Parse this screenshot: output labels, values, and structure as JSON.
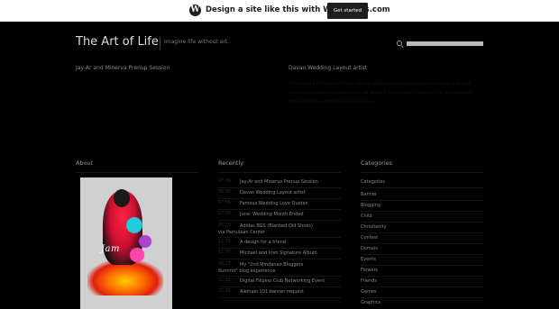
{
  "banner": {
    "logo": "W",
    "text": "Design a site like this with WordPress.com",
    "button": "Get started"
  },
  "header": {
    "title": "The Art of Life",
    "tagline": "Imagine life without art..",
    "search_icon": "search-icon",
    "search_placeholder": ""
  },
  "posts": [
    {
      "title": "Jay-Ar and Minerva Prenup Session"
    },
    {
      "title": "Davao Wedding Layout artist",
      "excerpt": "I'm a layout artist based in Davao city. I do wedding layouts and personalised photo gifts. Just send me your photos and ideas and I will design it to your taste. Contact me for your wedding, debut, birthday and other special occasions."
    }
  ],
  "sections": {
    "about": "About",
    "recently": "Recently",
    "categories": "Categories"
  },
  "about_image_text": "Jam",
  "recent": [
    {
      "time": "07:36",
      "title": "Jay-Ar and Minerva Prenup Session"
    },
    {
      "time": "06:28",
      "title": "Davao Wedding Layout artist"
    },
    {
      "time": "07:56",
      "title": "Famous Wedding Love Quotes"
    },
    {
      "time": "07:29",
      "title": "June: Wedding Month Ended"
    },
    {
      "time": "06:19",
      "title": "Adidas BGS (Blanked Old Shoes) via Pamulaan Center"
    },
    {
      "time": "11:33",
      "title": "A design for a friend"
    },
    {
      "time": "11:06",
      "title": "Michael and Irish Signature Album"
    },
    {
      "time": "00:17",
      "title": "My \"2nd Mindanao Bloggers Summit\" blog experience"
    },
    {
      "time": "01:22",
      "title": "Digital Filipino Club Networking Event"
    },
    {
      "time": "01:25",
      "title": "Aleinaei 101 banner request"
    }
  ],
  "categories": [
    "Categories",
    "Banner",
    "Blogging",
    "Child",
    "Christianity",
    "Contest",
    "Domain",
    "Events",
    "Flowers",
    "Friends",
    "Games",
    "Graphics"
  ]
}
